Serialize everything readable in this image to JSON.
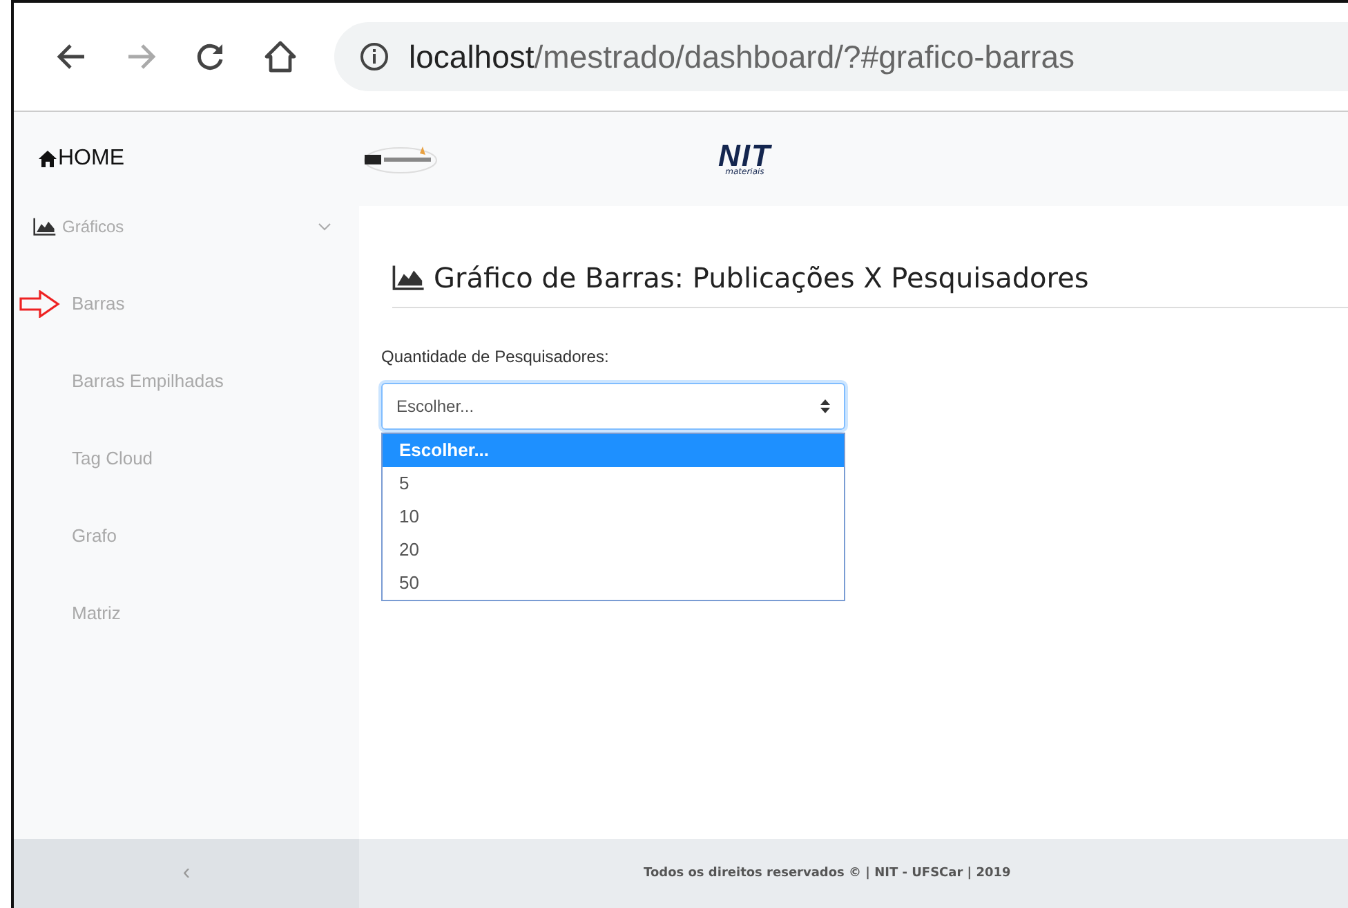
{
  "browser": {
    "url_host": "localhost",
    "url_path": "/mestrado/dashboard/?#grafico-barras"
  },
  "header": {
    "home": "HOME",
    "logo_text": "NIT",
    "logo_subtext": "materiais"
  },
  "sidebar": {
    "group": {
      "label": "Gráficos",
      "expanded": true
    },
    "items": [
      {
        "label": "Barras",
        "marked": true
      },
      {
        "label": "Barras Empilhadas",
        "marked": false
      },
      {
        "label": "Tag Cloud",
        "marked": false
      },
      {
        "label": "Grafo",
        "marked": false
      },
      {
        "label": "Matriz",
        "marked": false
      }
    ],
    "collapse": "‹"
  },
  "main": {
    "title": "Gráfico de Barras: Publicações X Pesquisadores",
    "field_label": "Quantidade de Pesquisadores:",
    "select_value": "Escolher...",
    "options": [
      {
        "label": "Escolher...",
        "selected": true
      },
      {
        "label": "5",
        "selected": false
      },
      {
        "label": "10",
        "selected": false
      },
      {
        "label": "20",
        "selected": false
      },
      {
        "label": "50",
        "selected": false
      }
    ]
  },
  "footer": "Todos os direitos reservados © | NIT - UFSCar | 2019"
}
